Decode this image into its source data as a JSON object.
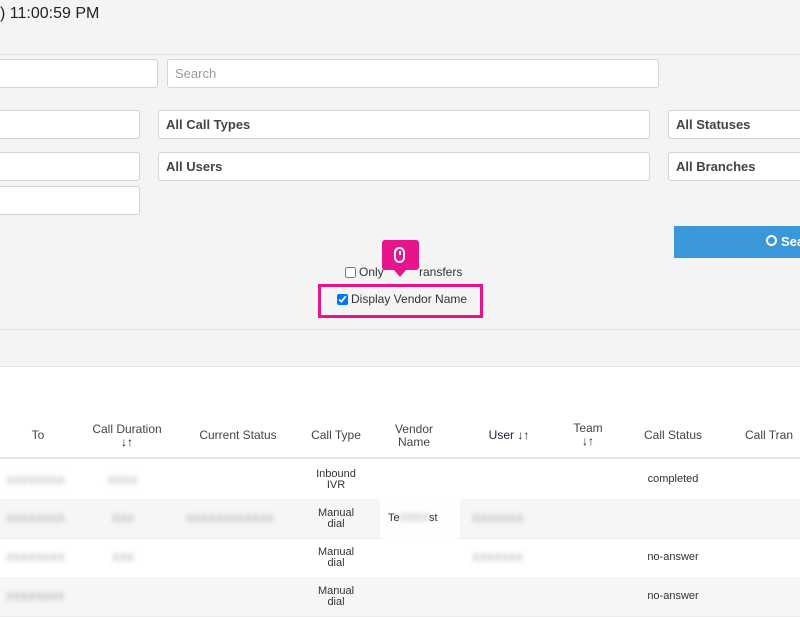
{
  "header": {
    "time": ") 11:00:59 PM"
  },
  "filters": {
    "search_placeholder": "Search",
    "call_types": "All Call Types",
    "statuses": "All Statuses",
    "users": "All Users",
    "branches": "All Branches",
    "search_button": "Sea"
  },
  "options": {
    "only_transfers_a": "Only",
    "only_transfers_b": "ransfers",
    "display_vendor_name": "Display Vendor Name"
  },
  "colors": {
    "highlight": "#e8148b",
    "button": "#3a97d9"
  },
  "icons": {
    "cursor": "mouse-icon",
    "search": "search-icon",
    "sort": "sort-icon"
  },
  "table": {
    "columns": {
      "to": "To",
      "call_duration": "Call Duration",
      "current_status": "Current Status",
      "call_type": "Call Type",
      "vendor_name_1": "Vendor",
      "vendor_name_2": "Name",
      "user": "User",
      "team": "Team",
      "call_status": "Call Status",
      "call_transfer": "Call Tran"
    },
    "sort_glyph": "↓↑",
    "rows": [
      {
        "call_type_1": "Inbound",
        "call_type_2": "IVR",
        "vendor": "",
        "call_status": "completed"
      },
      {
        "call_type_1": "Manual",
        "call_type_2": "dial",
        "vendor_a": "Te",
        "vendor_b": "st",
        "call_status": ""
      },
      {
        "call_type_1": "Manual",
        "call_type_2": "dial",
        "vendor": "",
        "call_status": "no-answer"
      },
      {
        "call_type_1": "Manual",
        "call_type_2": "dial",
        "vendor": "",
        "call_status": "no-answer"
      }
    ]
  }
}
